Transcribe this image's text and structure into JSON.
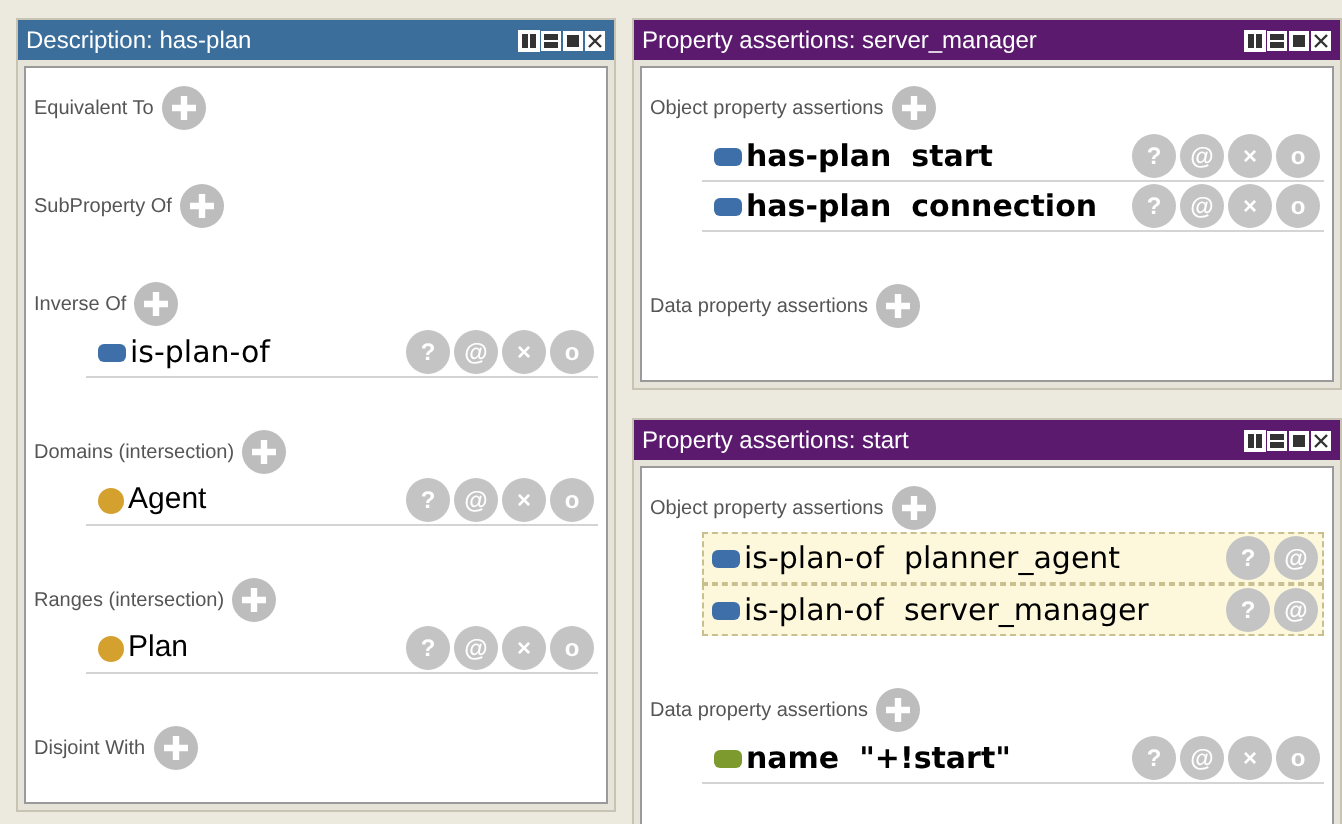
{
  "panels": [
    {
      "title": "Description: has-plan",
      "color": "#3b6e9a",
      "sections": [
        {
          "label": "Equivalent To"
        },
        {
          "label": "SubProperty Of"
        },
        {
          "label": "Inverse Of",
          "items": [
            {
              "kind": "object",
              "parts": [
                "is-plan-of"
              ],
              "bold": false,
              "inferred": false,
              "actions": [
                "?",
                "@",
                "×",
                "o"
              ]
            }
          ]
        },
        {
          "label": "Domains (intersection)",
          "items": [
            {
              "kind": "class",
              "parts": [
                "Agent"
              ],
              "bold": false,
              "inferred": false,
              "actions": [
                "?",
                "@",
                "×",
                "o"
              ]
            }
          ]
        },
        {
          "label": "Ranges (intersection)",
          "items": [
            {
              "kind": "class",
              "parts": [
                "Plan"
              ],
              "bold": false,
              "inferred": false,
              "actions": [
                "?",
                "@",
                "×",
                "o"
              ]
            }
          ]
        },
        {
          "label": "Disjoint With"
        }
      ]
    },
    {
      "title": "Property assertions: server_manager",
      "color": "#5b1a6e",
      "sections": [
        {
          "label": "Object property assertions",
          "items": [
            {
              "kind": "object",
              "parts": [
                "has-plan",
                "start"
              ],
              "bold": true,
              "inferred": false,
              "actions": [
                "?",
                "@",
                "×",
                "o"
              ]
            },
            {
              "kind": "object",
              "parts": [
                "has-plan",
                "connection"
              ],
              "bold": true,
              "inferred": false,
              "actions": [
                "?",
                "@",
                "×",
                "o"
              ]
            }
          ]
        },
        {
          "label": "Data property assertions"
        }
      ]
    },
    {
      "title": "Property assertions: start",
      "color": "#5b1a6e",
      "sections": [
        {
          "label": "Object property assertions",
          "items": [
            {
              "kind": "object",
              "parts": [
                "is-plan-of",
                "planner_agent"
              ],
              "bold": false,
              "inferred": true,
              "actions": [
                "?",
                "@"
              ]
            },
            {
              "kind": "object",
              "parts": [
                "is-plan-of",
                "server_manager"
              ],
              "bold": false,
              "inferred": true,
              "actions": [
                "?",
                "@"
              ]
            }
          ]
        },
        {
          "label": "Data property assertions",
          "items": [
            {
              "kind": "data",
              "parts": [
                "name",
                "\"+!start\""
              ],
              "bold": true,
              "inferred": false,
              "actions": [
                "?",
                "@",
                "×",
                "o"
              ]
            }
          ]
        }
      ]
    }
  ]
}
